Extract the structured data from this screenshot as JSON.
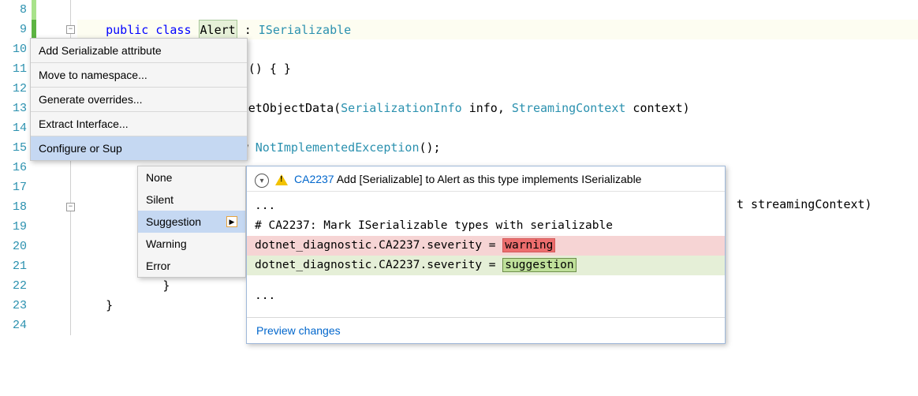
{
  "gutter": {
    "l8": "8",
    "l9": "9",
    "l10": "10",
    "l11": "11",
    "l12": "12",
    "l13": "13",
    "l14": "14",
    "l15": "15",
    "l16": "16",
    "l17": "17",
    "l18": "18",
    "l19": "19",
    "l20": "20",
    "l21": "21",
    "l22": "22",
    "l23": "23",
    "l24": "24"
  },
  "code": {
    "line9_prefix": "    ",
    "kw_public": "public",
    "kw_class": "class",
    "alert": "Alert",
    "colon": " : ",
    "iserializable": "ISerializable",
    "line11_suffix": "() { }",
    "line13_method": "GetObjectData",
    "line13_open": "(",
    "line13_t1": "SerializationInfo",
    "line13_p1": " info, ",
    "line13_t2": "StreamingContext",
    "line13_p2": " context)",
    "line15_pre": "w ",
    "line15_type": "NotImplementedException",
    "line15_post": "();",
    "line18_tail": "t streamingContext)",
    "line22_brace1": "            }",
    "line23_brace2": "    }"
  },
  "menu1": {
    "add_serializable": "Add Serializable attribute",
    "move_ns": "Move to namespace...",
    "gen_overrides": "Generate overrides...",
    "extract_iface": "Extract Interface...",
    "configure": "Configure or Sup"
  },
  "menu2": {
    "none": "None",
    "silent": "Silent",
    "suggestion": "Suggestion",
    "warning": "Warning",
    "error": "Error"
  },
  "preview": {
    "rule_id": "CA2237",
    "title_rest": "Add [Serializable] to Alert as this type implements ISerializable",
    "ellipsis1": "...",
    "comment": "# CA2237: Mark ISerializable types with serializable",
    "diff_prefix": "dotnet_diagnostic.CA2237.severity = ",
    "del_word": "warning",
    "add_word": "suggestion",
    "ellipsis2": "...",
    "footer": "Preview changes"
  }
}
